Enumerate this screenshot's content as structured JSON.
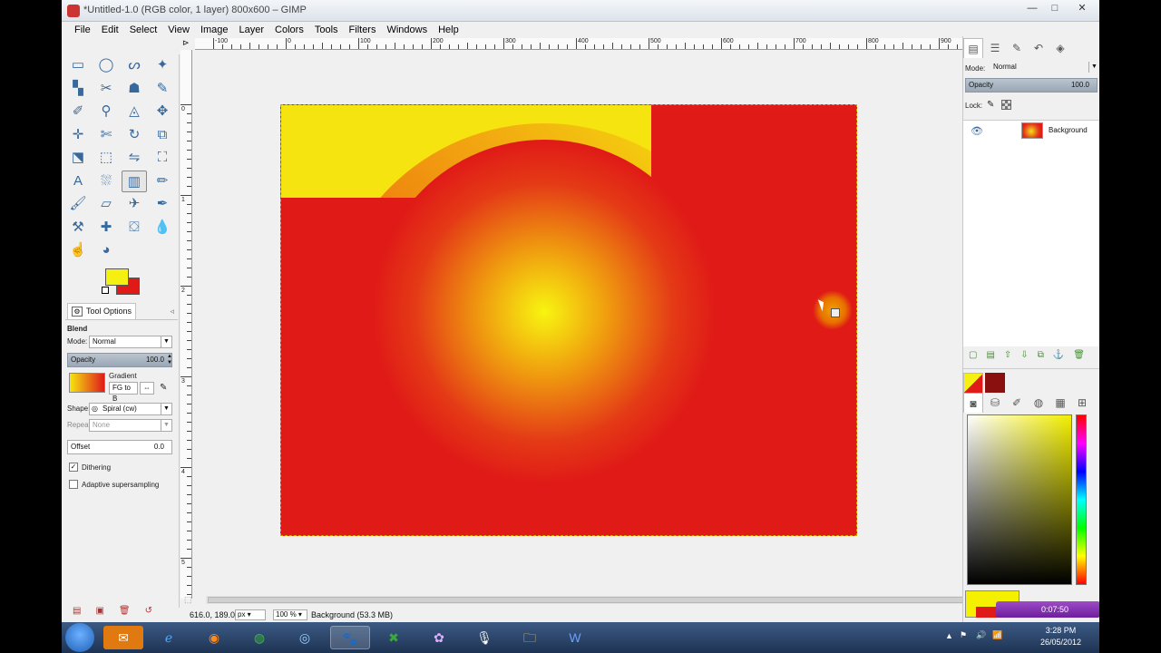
{
  "window": {
    "title": "*Untitled-1.0 (RGB color, 1 layer) 800x600 – GIMP",
    "buttons": {
      "minimize": "—",
      "maximize": "□",
      "close": "✕"
    }
  },
  "menu": [
    "File",
    "Edit",
    "Select",
    "View",
    "Image",
    "Layer",
    "Colors",
    "Tools",
    "Filters",
    "Windows",
    "Help"
  ],
  "toolbox": {
    "tools": [
      {
        "name": "rect-select-icon",
        "glyph": "▭"
      },
      {
        "name": "ellipse-select-icon",
        "glyph": "◯"
      },
      {
        "name": "lasso-icon",
        "glyph": "ᔕ"
      },
      {
        "name": "fuzzy-select-icon",
        "glyph": "✦"
      },
      {
        "name": "color-select-icon",
        "glyph": "▚"
      },
      {
        "name": "scissors-icon",
        "glyph": "✂"
      },
      {
        "name": "foreground-select-icon",
        "glyph": "☗"
      },
      {
        "name": "paths-icon",
        "glyph": "✎"
      },
      {
        "name": "color-picker-icon",
        "glyph": "✐"
      },
      {
        "name": "zoom-icon",
        "glyph": "⚲"
      },
      {
        "name": "measure-icon",
        "glyph": "◬"
      },
      {
        "name": "move-icon",
        "glyph": "✥"
      },
      {
        "name": "align-icon",
        "glyph": "✛"
      },
      {
        "name": "crop-icon",
        "glyph": "✄"
      },
      {
        "name": "rotate-icon",
        "glyph": "↻"
      },
      {
        "name": "scale-icon",
        "glyph": "⧉"
      },
      {
        "name": "shear-icon",
        "glyph": "⬔"
      },
      {
        "name": "perspective-icon",
        "glyph": "⬚"
      },
      {
        "name": "flip-icon",
        "glyph": "⇋"
      },
      {
        "name": "cage-icon",
        "glyph": "⛶"
      },
      {
        "name": "text-icon",
        "glyph": "A"
      },
      {
        "name": "bucket-fill-icon",
        "glyph": "⛆"
      },
      {
        "name": "blend-icon",
        "glyph": "▥"
      },
      {
        "name": "pencil-icon",
        "glyph": "✏"
      },
      {
        "name": "paintbrush-icon",
        "glyph": "🖌"
      },
      {
        "name": "eraser-icon",
        "glyph": "▱"
      },
      {
        "name": "airbrush-icon",
        "glyph": "✈"
      },
      {
        "name": "ink-icon",
        "glyph": "✒"
      },
      {
        "name": "clone-icon",
        "glyph": "⚒"
      },
      {
        "name": "heal-icon",
        "glyph": "✚"
      },
      {
        "name": "perspective-clone-icon",
        "glyph": "⛋"
      },
      {
        "name": "blur-icon",
        "glyph": "💧"
      },
      {
        "name": "smudge-icon",
        "glyph": "☝"
      },
      {
        "name": "dodge-burn-icon",
        "glyph": "◕"
      }
    ],
    "active_index": 22,
    "fg_color": "#f5f011",
    "bg_color": "#e01a17"
  },
  "tool_options": {
    "tab_label": "Tool Options",
    "tool_name": "Blend",
    "mode_label": "Mode:",
    "mode_value": "Normal",
    "opacity_label": "Opacity",
    "opacity_value": "100.0",
    "gradient_label": "Gradient",
    "gradient_value": "FG to B",
    "shape_label": "Shape:",
    "shape_value": "Spiral (cw)",
    "repeat_label": "Repeat:",
    "repeat_value": "None",
    "offset_label": "Offset",
    "offset_value": "0.0",
    "dithering_label": "Dithering",
    "dithering_checked": "✓",
    "adaptive_label": "Adaptive supersampling"
  },
  "rulers": {
    "top": [
      "-100",
      "0",
      "100",
      "200",
      "300",
      "400",
      "500",
      "600",
      "700",
      "800",
      "900"
    ],
    "left": [
      "0",
      "1",
      "2",
      "3",
      "4",
      "5"
    ]
  },
  "status": {
    "coords": "616.0, 189.0",
    "unit": "px",
    "zoom": "100 %",
    "message": "Background (53.3 MB)"
  },
  "layers": {
    "mode_label": "Mode:",
    "mode_value": "Normal",
    "opacity_label": "Opacity",
    "opacity_value": "100.0",
    "lock_label": "Lock:",
    "layer_name": "Background"
  },
  "recorder": {
    "time": "0:07:50"
  },
  "taskbar": {
    "time": "3:28 PM",
    "date": "26/05/2012"
  }
}
